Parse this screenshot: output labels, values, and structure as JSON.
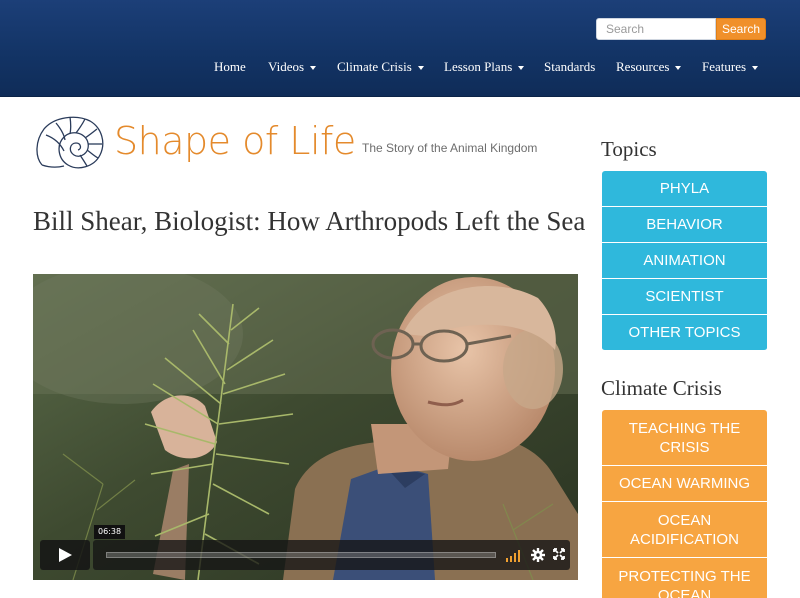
{
  "header": {
    "search": {
      "placeholder": "Search",
      "button_label": "Search"
    },
    "nav": [
      {
        "label": "Home",
        "dropdown": false
      },
      {
        "label": "Videos",
        "dropdown": true
      },
      {
        "label": "Climate Crisis",
        "dropdown": true
      },
      {
        "label": "Lesson Plans",
        "dropdown": true
      },
      {
        "label": "Standards",
        "dropdown": false
      },
      {
        "label": "Resources",
        "dropdown": true
      },
      {
        "label": "Features",
        "dropdown": true
      }
    ]
  },
  "logo": {
    "title": "Shape of Life",
    "tagline": "The Story of the Animal Kingdom"
  },
  "page": {
    "title": "Bill Shear, Biologist: How Arthropods Left the Sea"
  },
  "video": {
    "timestamp": "06:38",
    "progress": 0
  },
  "sidebar": {
    "topics_heading": "Topics",
    "topics": [
      "PHYLA",
      "BEHAVIOR",
      "ANIMATION",
      "SCIENTIST",
      "OTHER TOPICS"
    ],
    "climate_heading": "Climate Crisis",
    "climate": [
      "TEACHING THE CRISIS",
      "OCEAN WARMING",
      "OCEAN ACIDIFICATION",
      "PROTECTING THE OCEAN"
    ]
  },
  "colors": {
    "header_bg": "#15376c",
    "accent_orange": "#f0902a",
    "topics_blue": "#2fb8dc",
    "climate_orange": "#f7a541",
    "logo_orange": "#e48a2c"
  },
  "icons": [
    "nautilus-logo-icon",
    "play-icon",
    "volume-icon",
    "settings-gear-icon",
    "fullscreen-icon",
    "caret-down-icon"
  ]
}
